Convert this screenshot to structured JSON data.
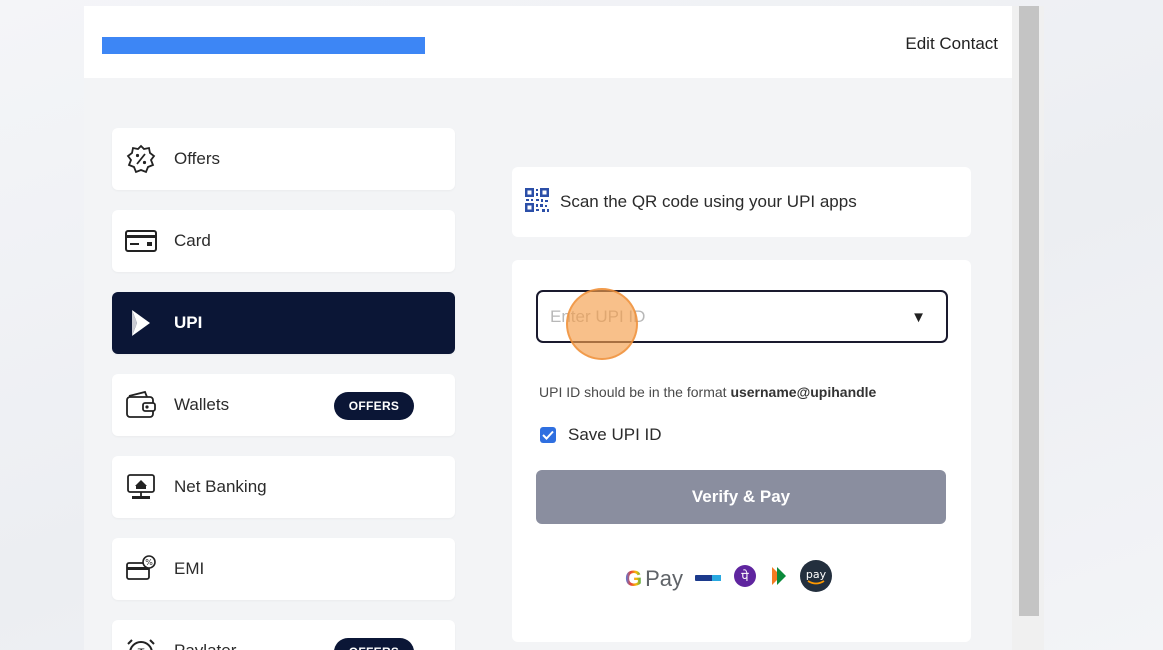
{
  "header": {
    "edit_contact": "Edit Contact"
  },
  "methods": [
    {
      "label": "Offers",
      "icon": "offer-percent-icon",
      "badge": ""
    },
    {
      "label": "Card",
      "icon": "card-icon",
      "badge": ""
    },
    {
      "label": "UPI",
      "icon": "upi-icon",
      "badge": "",
      "active": true
    },
    {
      "label": "Wallets",
      "icon": "wallet-icon",
      "badge": "OFFERS"
    },
    {
      "label": "Net Banking",
      "icon": "net-banking-icon",
      "badge": ""
    },
    {
      "label": "EMI",
      "icon": "emi-icon",
      "badge": ""
    },
    {
      "label": "Paylater",
      "icon": "paylater-icon",
      "badge": "OFFERS"
    }
  ],
  "qr": {
    "text": "Scan the QR code using your UPI apps",
    "icon": "qr-code-icon"
  },
  "upi": {
    "placeholder": "Enter UPI ID",
    "value": "",
    "hint_prefix": "UPI ID should be in the format ",
    "hint_format": "username@upihandle",
    "save_label": "Save UPI ID",
    "save_checked": true,
    "verify_label": "Verify & Pay"
  },
  "apps": {
    "gpay_g": "G",
    "gpay_pay": "Pay",
    "paytm": "Paytm",
    "amazon": "pay"
  },
  "colors": {
    "accent_dark": "#0b1636",
    "button_disabled": "#8a8e9f",
    "redaction": "#3d86f5",
    "checkbox": "#2f6fe0"
  }
}
